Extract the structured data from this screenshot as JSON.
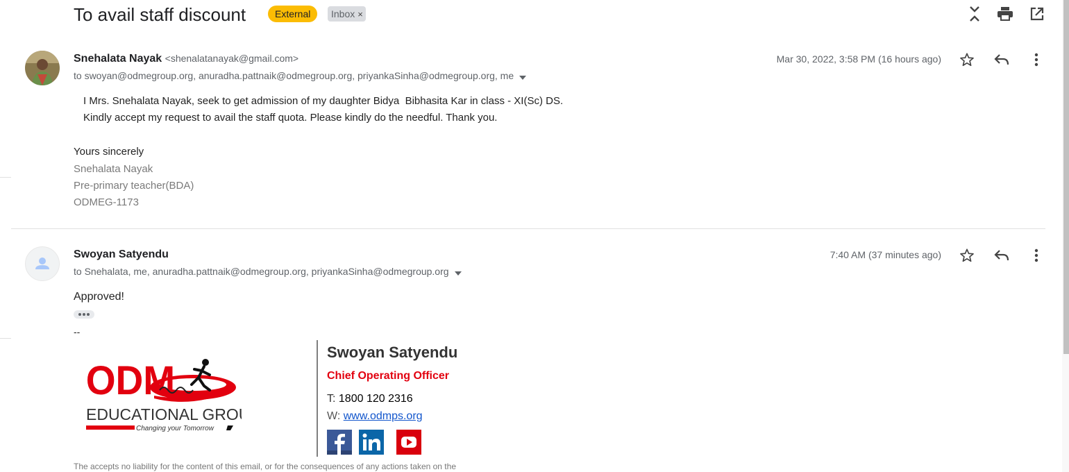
{
  "thread": {
    "subject": "To avail staff discount",
    "labels": {
      "external": "External",
      "inbox": "Inbox",
      "inbox_close": "×"
    }
  },
  "toolbar_icons": [
    "expand-collapse-icon",
    "print-icon",
    "open-in-new-window-icon"
  ],
  "message1": {
    "sender_name": "Snehalata Nayak",
    "sender_email": "<shenalatanayak@gmail.com>",
    "recipients": "to swoyan@odmegroup.org, anuradha.pattnaik@odmegroup.org, priyankaSinha@odmegroup.org, me",
    "date": "Mar 30, 2022, 3:58 PM (16 hours ago)",
    "body_lines": [
      "I Mrs. Snehalata Nayak, seek to get admission of my daughter Bidya  Bibhasita Kar in class - XI(Sc) DS.",
      "Kindly accept my request to avail the staff quota. Please kindly do the needful. Thank you."
    ],
    "closing": "Yours sincerely",
    "signature": [
      "Snehalata Nayak",
      "Pre-primary teacher(BDA)",
      "ODMEG-1173"
    ]
  },
  "message2": {
    "sender_name": "Swoyan Satyendu",
    "recipients": "to Snehalata, me, anuradha.pattnaik@odmegroup.org, priyankaSinha@odmegroup.org",
    "date": "7:40 AM (37 minutes ago)",
    "body": "Approved!",
    "sig_separator": "--",
    "signature": {
      "logo_text": "ODM",
      "logo_sub": "EDUCATIONAL GROUP",
      "logo_tagline": "Changing your Tomorrow",
      "name": "Swoyan Satyendu",
      "title": "Chief Operating Officer",
      "phone_label": "T:",
      "phone": "1800 120 2316",
      "web_label": "W:",
      "web": "www.odmps.org",
      "social": [
        "facebook-icon",
        "linkedin-icon",
        "youtube-icon"
      ]
    },
    "disclaimer": "The accepts no liability for the content of this email, or for the consequences of any actions taken on the"
  },
  "colors": {
    "external_label": "#fbbc04",
    "inbox_label": "#dadce0",
    "title_red": "#e2000f",
    "link_blue": "#1155cc"
  }
}
